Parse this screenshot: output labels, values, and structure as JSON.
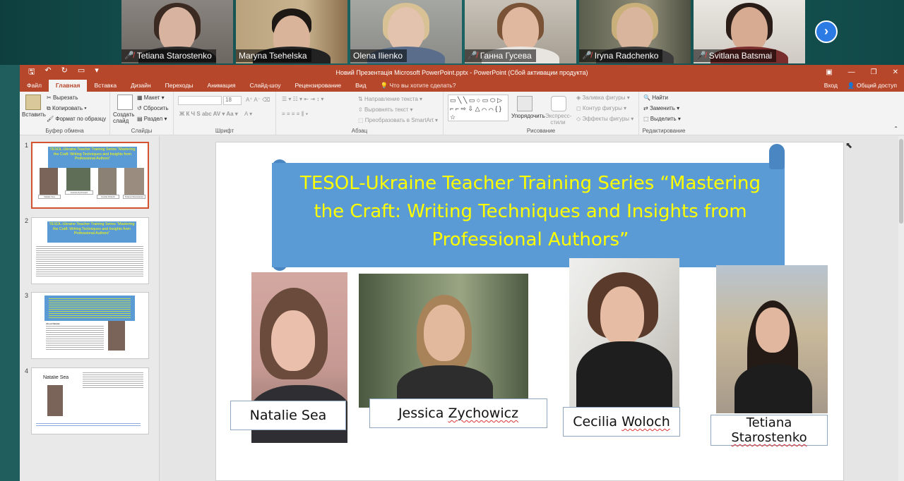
{
  "zoom": {
    "participants": [
      {
        "name": "Tetiana Starostenko",
        "muted": true
      },
      {
        "name": "Maryna Tsehelska",
        "muted": false
      },
      {
        "name": "Olena Ilienko",
        "muted": false
      },
      {
        "name": "Ганна Гусева",
        "muted": true
      },
      {
        "name": "Iryna Radchenko",
        "muted": true
      },
      {
        "name": "Svitlana Batsmai",
        "muted": true
      }
    ],
    "next_icon": "›"
  },
  "ppt": {
    "window_title": "Новий Презентація Microsoft PowerPoint.pptx - PowerPoint (Сбой активации продукта)",
    "tabs": [
      "Файл",
      "Главная",
      "Вставка",
      "Дизайн",
      "Переходы",
      "Анимация",
      "Слайд-шоу",
      "Рецензирование",
      "Вид"
    ],
    "selected_tab": "Главная",
    "tell_me": "Что вы хотите сделать?",
    "sign_in": "Вход",
    "share": "Общий доступ",
    "ribbon": {
      "paste": "Вставить",
      "cut": "Вырезать",
      "copy": "Копировать",
      "format_painter": "Формат по образцу",
      "clipboard_group": "Буфер обмена",
      "new_slide": "Создать слайд",
      "layout": "Макет",
      "reset": "Сбросить",
      "section": "Раздел",
      "slides_group": "Слайды",
      "font_size": "18",
      "font_group": "Шрифт",
      "text_direction": "Направление текста",
      "align_text": "Выровнять текст",
      "smartart": "Преобразовать в SmartArt",
      "paragraph_group": "Абзац",
      "arrange": "Упорядочить",
      "quick_styles": "Экспресс-стили",
      "shape_fill": "Заливка фигуры",
      "shape_outline": "Контур фигуры",
      "shape_effects": "Эффекты фигуры",
      "drawing_group": "Рисование",
      "find": "Найти",
      "replace": "Заменить",
      "select": "Выделить",
      "editing_group": "Редактирование"
    },
    "thumbnails": [
      {
        "num": "1",
        "title": "TESOL-Ukraine Teacher Training Series “Mastering the Craft: Writing Techniques and Insights from Professional Authors”",
        "names": [
          "Natalie Sea",
          "Jessica Zychowicz",
          "Cecilia Woloch",
          "Tetiana Starostenko"
        ]
      },
      {
        "num": "2",
        "title": "TESOL-Ukraine Teacher Training Series “Mastering the Craft: Writing Techniques and Insights from Professional Authors”"
      },
      {
        "num": "3",
        "author": "About Natalie:"
      },
      {
        "num": "4",
        "title": "Natalie Sea"
      }
    ],
    "slide": {
      "title": "TESOL-Ukraine Teacher Training Series “Mastering the Craft: Writing Techniques and Insights from Professional Authors”",
      "speakers": [
        {
          "name": "Natalie Sea"
        },
        {
          "name_first": "Jessica ",
          "name_last": "Zychowicz"
        },
        {
          "name_first": "Cecilia ",
          "name_last": "Woloch"
        },
        {
          "name_first": "Tetiana",
          "name_last": "Starostenko"
        }
      ]
    }
  },
  "colors": {
    "ppt_accent": "#b7472a",
    "banner": "#5b9bd5",
    "title_text": "#ffff00",
    "active_speaker": "#48d66b"
  }
}
